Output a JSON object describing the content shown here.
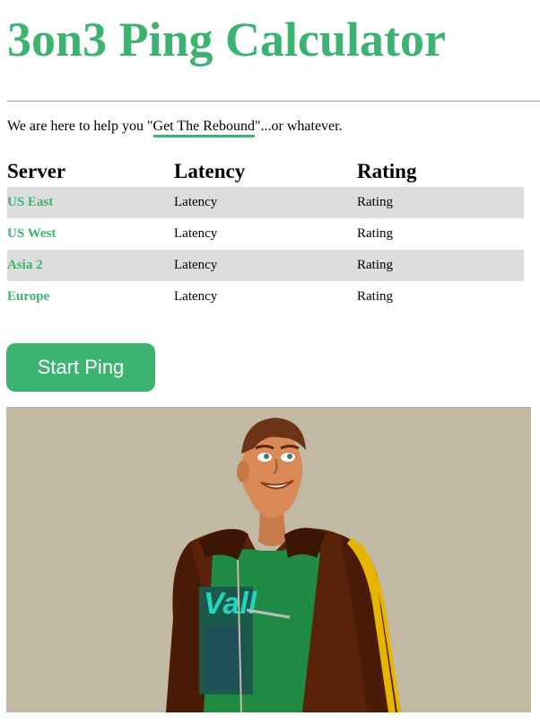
{
  "page": {
    "title": "3on3 Ping Calculator",
    "tagline_before": "We are here to help you \"",
    "tagline_link": "Get The Rebound",
    "tagline_after": "\"...or whatever."
  },
  "table": {
    "headers": {
      "server": "Server",
      "latency": "Latency",
      "rating": "Rating"
    },
    "rows": [
      {
        "server": "US East",
        "latency": "Latency",
        "rating": "Rating"
      },
      {
        "server": "US West",
        "latency": "Latency",
        "rating": "Rating"
      },
      {
        "server": "Asia 2",
        "latency": "Latency",
        "rating": "Rating"
      },
      {
        "server": "Europe",
        "latency": "Latency",
        "rating": "Rating"
      }
    ]
  },
  "actions": {
    "start_ping_label": "Start Ping"
  },
  "hero": {
    "image": "basketball-character-illustration",
    "shirt_text": "Vall"
  },
  "colors": {
    "accent": "#3cb371",
    "row_shade": "#dddddd",
    "hero_background": "#c2b9a4"
  }
}
